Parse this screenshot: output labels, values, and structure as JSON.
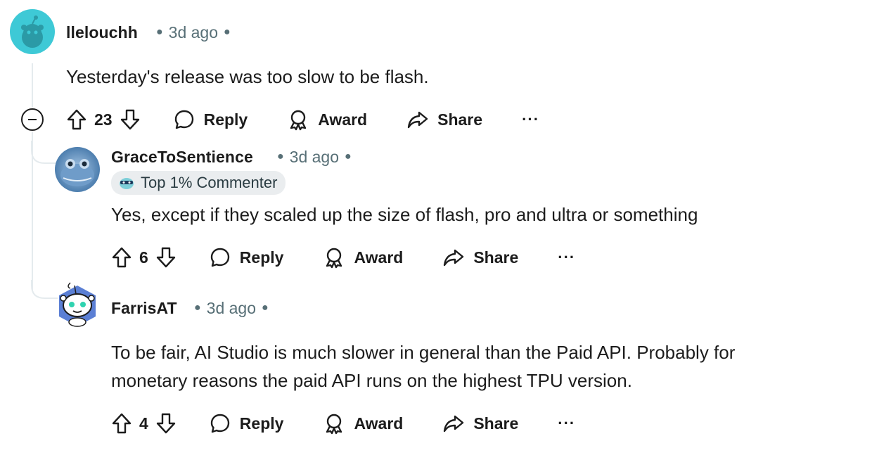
{
  "comments": [
    {
      "username": "llelouchh",
      "age": "3d ago",
      "text": "Yesterday's release was too slow to be flash.",
      "votes": "23",
      "actions": {
        "reply": "Reply",
        "award": "Award",
        "share": "Share"
      },
      "more": "···"
    },
    {
      "username": "GraceToSentience",
      "age": "3d ago",
      "flair": "Top 1% Commenter",
      "text": "Yes, except if they scaled up the size of flash, pro and ultra or something",
      "votes": "6",
      "actions": {
        "reply": "Reply",
        "award": "Award",
        "share": "Share"
      },
      "more": "···"
    },
    {
      "username": "FarrisAT",
      "age": "3d ago",
      "text_line1": "To be fair, AI Studio is much slower in general than the Paid API. Probably for",
      "text_line2": "monetary reasons the paid API runs on the highest TPU version.",
      "votes": "4",
      "actions": {
        "reply": "Reply",
        "award": "Award",
        "share": "Share"
      },
      "more": "···"
    }
  ],
  "colors": {
    "avatar1": "#3ec9d6",
    "thread": "#e5ebee",
    "meta": "#576f76"
  }
}
